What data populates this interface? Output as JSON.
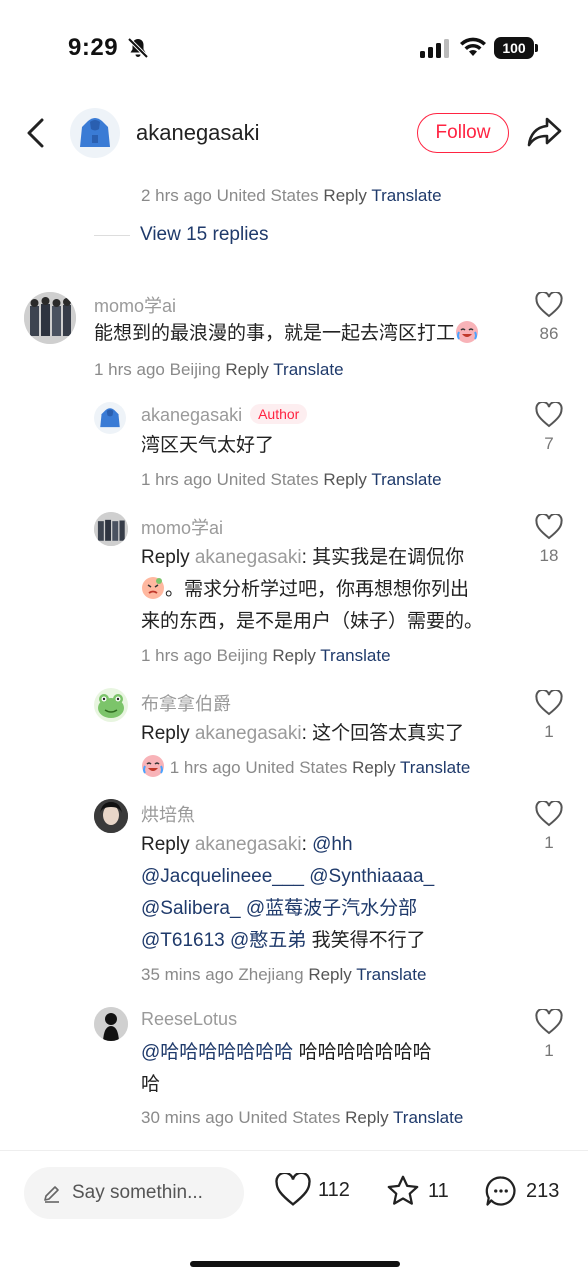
{
  "status": {
    "time": "9:29",
    "battery": "100"
  },
  "header": {
    "username": "akanegasaki",
    "follow_label": "Follow"
  },
  "top_meta": {
    "time": "2 hrs ago",
    "location": "United States",
    "reply": "Reply",
    "translate": "Translate"
  },
  "view_replies_label": "View 15 replies",
  "comments": [
    {
      "username": "momo学ai",
      "text": "能想到的最浪漫的事，就是一起去湾区打工",
      "time": "1 hrs ago",
      "location": "Beijing",
      "reply": "Reply",
      "translate": "Translate",
      "likes": "86"
    },
    {
      "username": "akanegasaki",
      "badge": "Author",
      "text": "湾区天气太好了",
      "time": "1 hrs ago",
      "location": "United States",
      "reply": "Reply",
      "translate": "Translate",
      "likes": "7"
    },
    {
      "username": "momo学ai",
      "reply_prefix": "Reply",
      "reply_to": "akanegasaki",
      "text_line1": ": 其实我是在调侃你",
      "text_line2": "。需求分析学过吧，你再想想你列出",
      "text_line3": "来的东西，是不是用户（妹子）需要的。",
      "time": "1 hrs ago",
      "location": "Beijing",
      "reply": "Reply",
      "translate": "Translate",
      "likes": "18"
    },
    {
      "username": "布拿拿伯爵",
      "reply_prefix": "Reply",
      "reply_to": "akanegasaki",
      "text": ": 这个回答太真实了",
      "time": "1 hrs ago",
      "location": "United States",
      "reply": "Reply",
      "translate": "Translate",
      "likes": "1"
    },
    {
      "username": "烘培魚",
      "reply_prefix": "Reply",
      "reply_to": "akanegasaki",
      "mention_hh": "@hh",
      "mention_1": "@Jacquelineee___",
      "mention_2": "@Synthiaaaa_",
      "mention_3": "@Salibera_",
      "mention_4": "@蓝莓波子汽水分部",
      "mention_5": "@T61613",
      "mention_6": "@憨五弟",
      "tail": "我笑得不行了",
      "time": "35 mins ago",
      "location": "Zhejiang",
      "reply": "Reply",
      "translate": "Translate",
      "likes": "1"
    },
    {
      "username": "ReeseLotus",
      "mention": "@哈哈哈哈哈哈哈",
      "tail_line1": "哈哈哈哈哈哈哈",
      "tail_line2": "哈",
      "time": "30 mins ago",
      "location": "United States",
      "reply": "Reply",
      "translate": "Translate",
      "likes": "1"
    }
  ],
  "bottom": {
    "input_placeholder": "Say somethin...",
    "likes": "112",
    "stars": "11",
    "comments": "213"
  },
  "colors": {
    "accent": "#ff2442",
    "link": "#1f3a6b"
  }
}
